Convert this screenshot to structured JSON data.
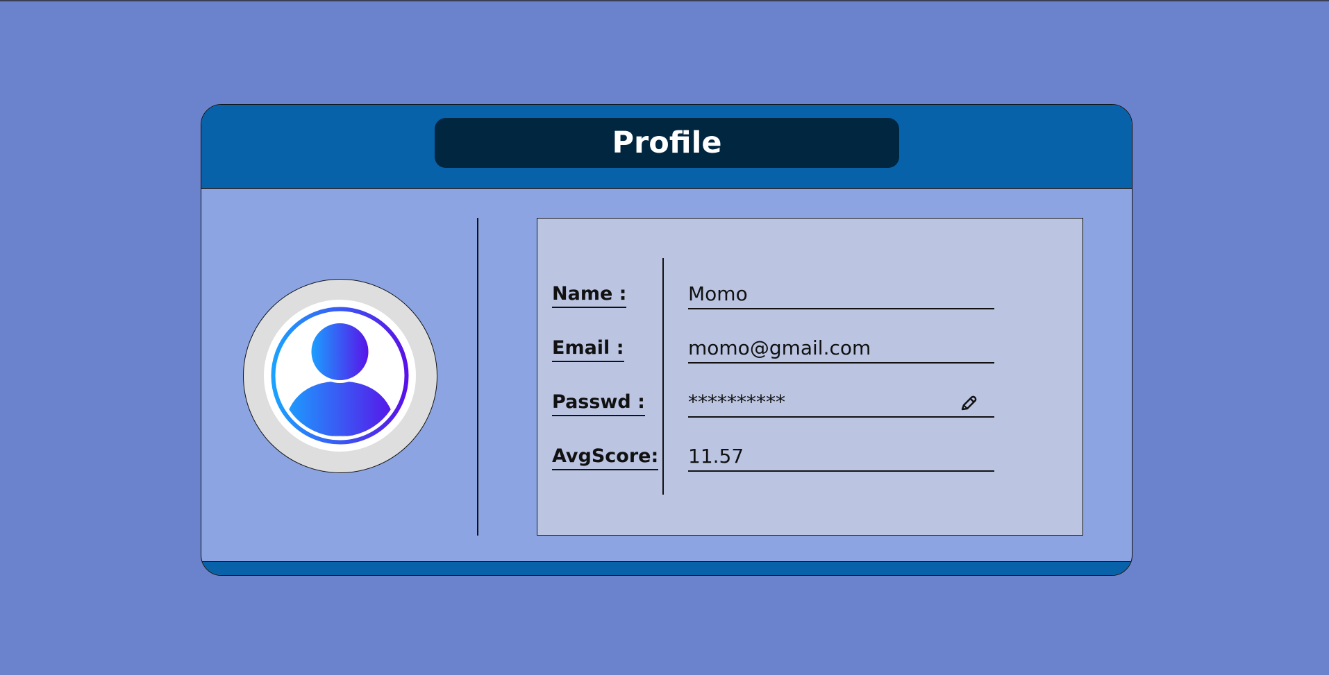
{
  "header": {
    "title": "Profile"
  },
  "avatar": {
    "icon": "user-avatar-icon",
    "gradient_start": "#1aa2ff",
    "gradient_end": "#5a10e8"
  },
  "profile": {
    "rows": [
      {
        "label": "Name :",
        "value": "Momo"
      },
      {
        "label": "Email :",
        "value": "momo@gmail.com"
      },
      {
        "label": "Passwd :",
        "value": "**********",
        "action_icon": "pencil-edit-icon"
      },
      {
        "label": "AvgScore:",
        "value": "11.57"
      }
    ]
  },
  "colors": {
    "background": "#6a83cc",
    "header": "#0762aa",
    "title_pill": "#002640",
    "card_body": "#8ca5e2",
    "info_panel": "#bbc5e2"
  }
}
